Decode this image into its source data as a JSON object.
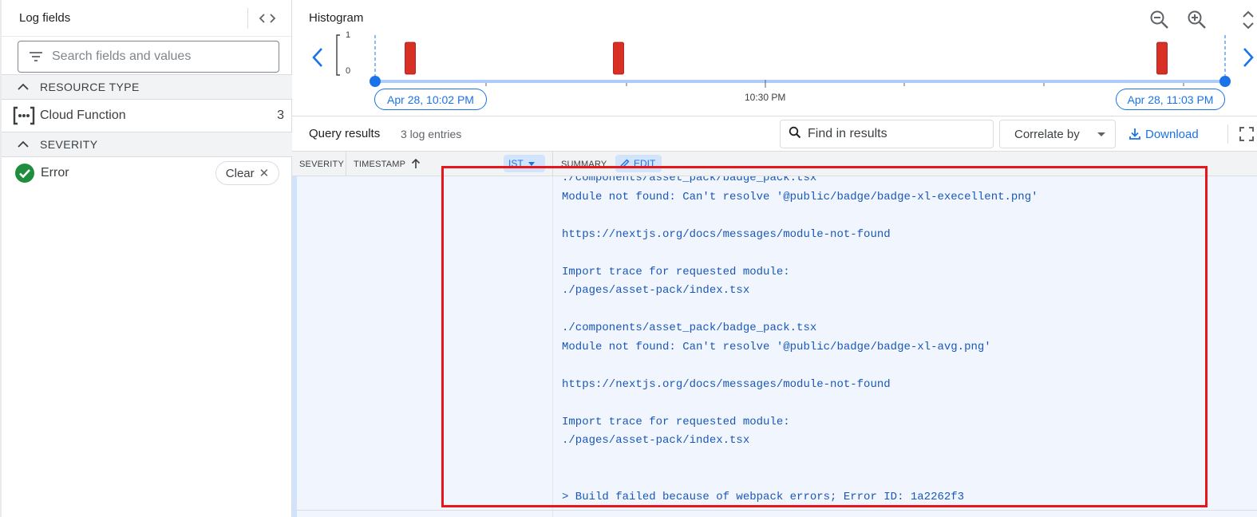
{
  "log_fields": {
    "title": "Log fields",
    "toggle_icon": "code-icon",
    "search_placeholder": "Search fields and values",
    "sections": [
      {
        "label": "RESOURCE TYPE",
        "items": [
          {
            "label": "Cloud Function",
            "count": "3",
            "icon": "cloud-functions-icon"
          }
        ]
      },
      {
        "label": "SEVERITY",
        "items": [
          {
            "label": "Error",
            "icon": "check-circle-icon",
            "action_label": "Clear"
          }
        ]
      }
    ]
  },
  "histogram": {
    "title": "Histogram",
    "y_max": "1",
    "y_min": "0",
    "start_label": "Apr 28, 10:02 PM",
    "mid_label": "10:30 PM",
    "end_label": "Apr 28, 11:03 PM",
    "bar_color": "#d93025",
    "accent": "#1a73e8",
    "bars": [
      {
        "time": "10:03 PM",
        "count": 1
      },
      {
        "time": "10:17 PM",
        "count": 1
      },
      {
        "time": "11:02 PM",
        "count": 1
      }
    ]
  },
  "query_results": {
    "title": "Query results",
    "count": "3 log entries",
    "find_placeholder": "Find in results",
    "correlate_label": "Correlate by",
    "download_label": "Download"
  },
  "table": {
    "headers": {
      "severity": "SEVERITY",
      "timestamp": "TIMESTAMP",
      "timezone": "IST",
      "summary": "SUMMARY",
      "edit": "EDIT"
    },
    "log_lines": [
      "./components/asset_pack/badge_pack.tsx",
      "Module not found: Can't resolve '@public/badge/badge-xl-execellent.png'",
      "",
      "https://nextjs.org/docs/messages/module-not-found",
      "",
      "Import trace for requested module:",
      "./pages/asset-pack/index.tsx",
      "",
      "./components/asset_pack/badge_pack.tsx",
      "Module not found: Can't resolve '@public/badge/badge-xl-avg.png'",
      "",
      "https://nextjs.org/docs/messages/module-not-found",
      "",
      "Import trace for requested module:",
      "./pages/asset-pack/index.tsx",
      "",
      "",
      "> Build failed because of webpack errors; Error ID: 1a2262f3"
    ]
  },
  "highlight_color": "#e8151b"
}
